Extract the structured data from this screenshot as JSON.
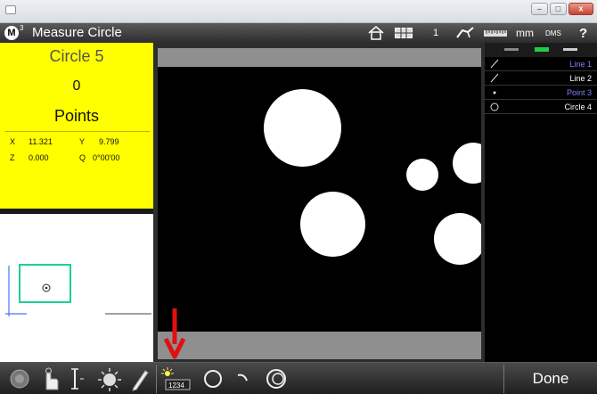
{
  "window": {
    "minimize_glyph": "–",
    "maximize_glyph": "□",
    "close_glyph": "x"
  },
  "toolbar": {
    "logo_letter": "M",
    "logo_sup": "3",
    "title": "Measure Circle",
    "count": "1",
    "units": "mm",
    "angle_format": "DMS",
    "help": "?"
  },
  "dro": {
    "feature_name": "Circle 5",
    "points_count": "0",
    "points_label": "Points",
    "x_label": "X",
    "x_value": "11.321",
    "y_label": "Y",
    "y_value": "9.799",
    "z_label": "Z",
    "z_value": "0.000",
    "q_label": "Q",
    "q_value": "0°00'00"
  },
  "features": [
    {
      "label": "Line 1",
      "icon": "line-icon",
      "color": "#8080ff"
    },
    {
      "label": "Line 2",
      "icon": "line-icon",
      "color": "#ffffff"
    },
    {
      "label": "Point 3",
      "icon": "point-icon",
      "color": "#8080ff"
    },
    {
      "label": "Circle 4",
      "icon": "circle-icon",
      "color": "#ffffff"
    }
  ],
  "bottom": {
    "probe_label": "1234",
    "done_label": "Done"
  },
  "colors": {
    "dro_background": "#ffff00",
    "overview_rect": "#00cc88",
    "arrow": "#e01010"
  }
}
